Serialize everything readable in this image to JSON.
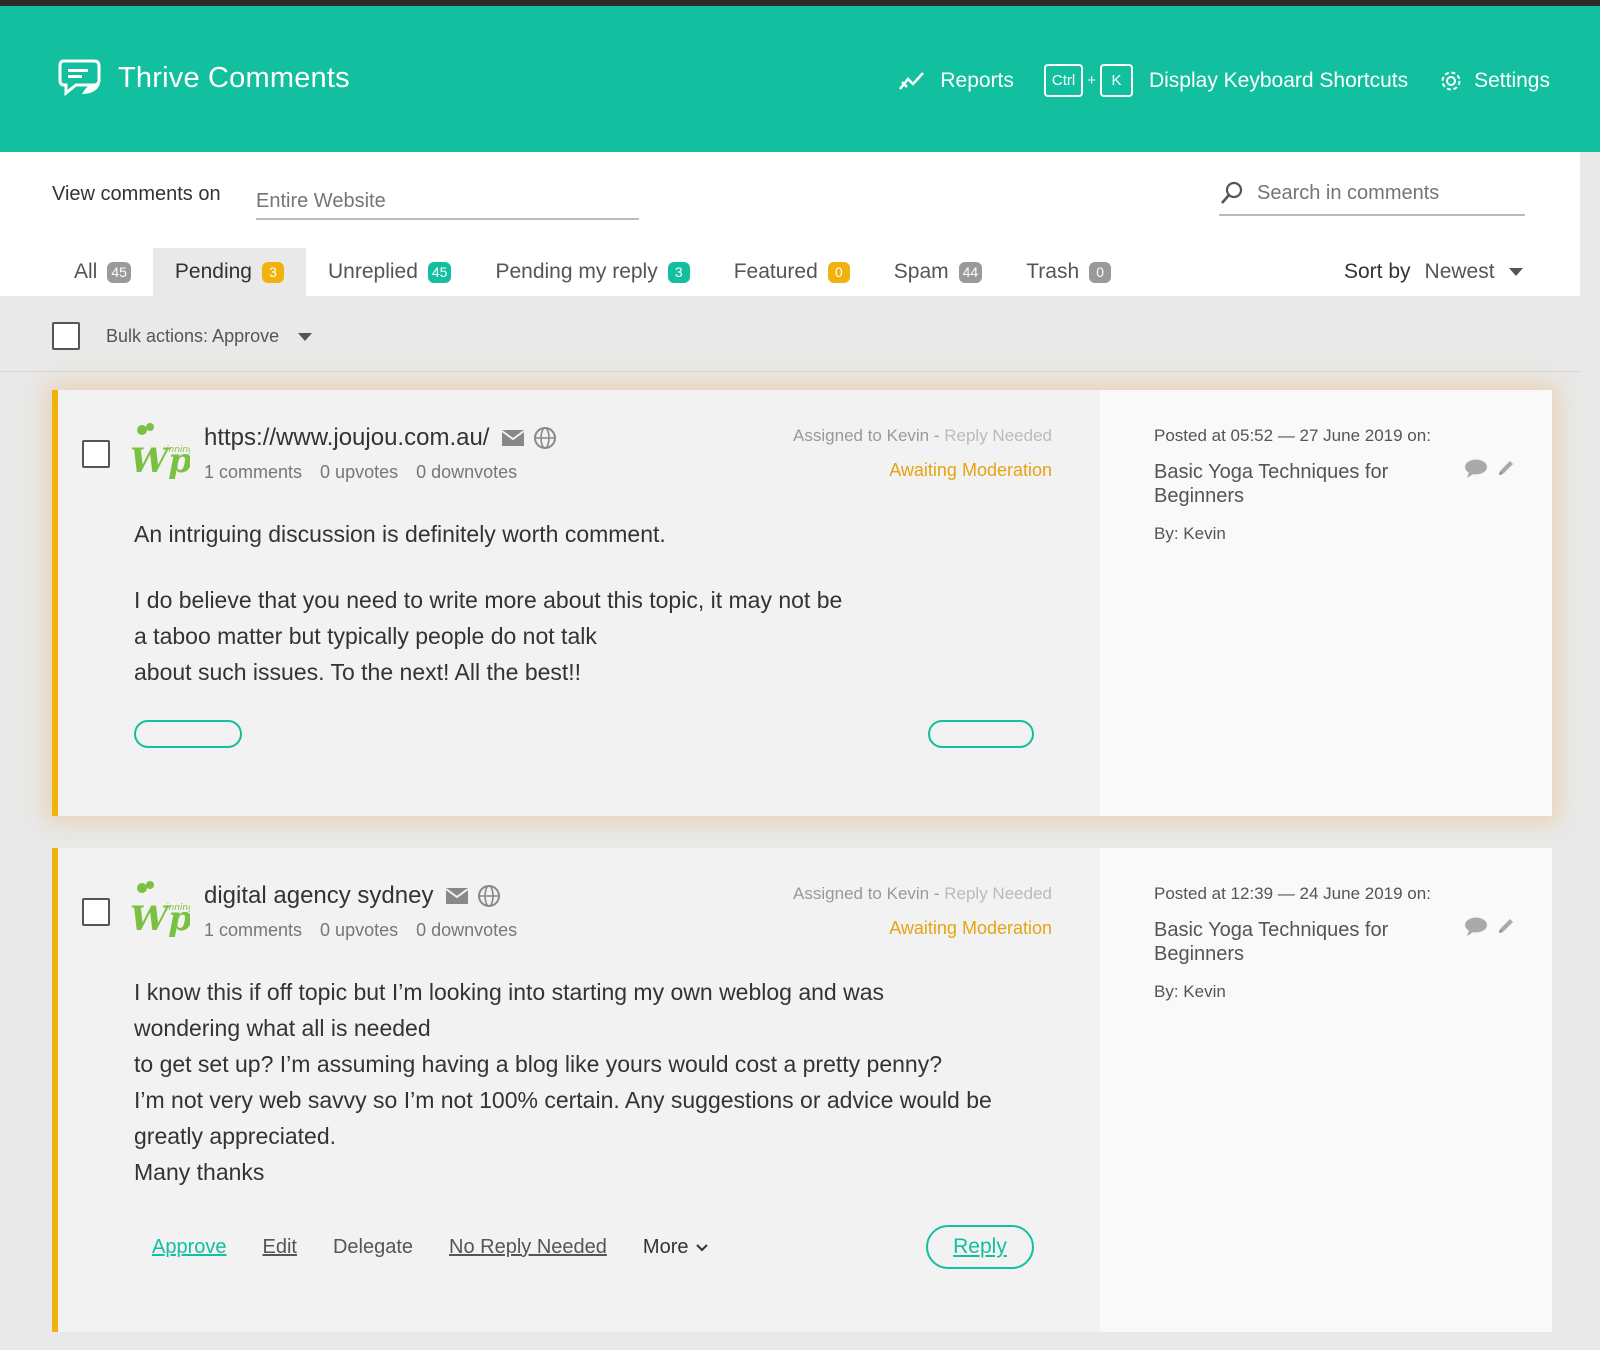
{
  "header": {
    "title": "Thrive Comments",
    "reports": "Reports",
    "kbd_ctrl": "Ctrl",
    "kbd_plus": "+",
    "kbd_k": "K",
    "shortcuts": "Display Keyboard Shortcuts",
    "settings": "Settings"
  },
  "filter": {
    "label": "View comments on",
    "placeholder": "Entire Website",
    "search_placeholder": "Search in comments"
  },
  "tabs": [
    {
      "label": "All",
      "count": "45",
      "color": "#9a9a9a"
    },
    {
      "label": "Pending",
      "count": "3",
      "color": "#f2b20d"
    },
    {
      "label": "Unreplied",
      "count": "45",
      "color": "#12bf9e"
    },
    {
      "label": "Pending my reply",
      "count": "3",
      "color": "#12bf9e"
    },
    {
      "label": "Featured",
      "count": "0",
      "color": "#f2b20d"
    },
    {
      "label": "Spam",
      "count": "44",
      "color": "#9a9a9a"
    },
    {
      "label": "Trash",
      "count": "0",
      "color": "#9a9a9a"
    }
  ],
  "sort": {
    "label": "Sort by",
    "value": "Newest"
  },
  "bulk": {
    "label": "Bulk actions:",
    "value": "Approve"
  },
  "comments": [
    {
      "author": "https://www.joujou.com.au/",
      "comments": "1 comments",
      "upvotes": "0 upvotes",
      "downvotes": "0 downvotes",
      "assigned": "Assigned to Kevin",
      "assigned_sep": " - ",
      "reply_needed": "Reply Needed",
      "status": "Awaiting Moderation",
      "body": [
        "An intriguing discussion is definitely worth comment.",
        "I do believe that you need to write more about this topic, it may not be",
        "a taboo matter but typically people do not talk",
        "about such issues. To the next! All the best!!"
      ],
      "posted": "Posted at 05:52 — 27 June 2019 on:",
      "post_title": "Basic Yoga Techniques for Beginners",
      "by": "By: Kevin"
    },
    {
      "author": "digital agency sydney",
      "comments": "1 comments",
      "upvotes": "0 upvotes",
      "downvotes": "0 downvotes",
      "assigned": "Assigned to Kevin",
      "assigned_sep": " - ",
      "reply_needed": "Reply Needed",
      "status": "Awaiting Moderation",
      "body": [
        "I know this if off topic but I’m looking into starting my own weblog and was",
        "wondering what all is needed",
        "to get set up? I’m assuming having a blog like yours would cost a pretty penny?",
        "I’m not very web savvy so I’m not 100% certain. Any suggestions or advice would be",
        "greatly appreciated.",
        "Many thanks"
      ],
      "posted": "Posted at 12:39 — 24 June 2019 on:",
      "post_title": "Basic Yoga Techniques for Beginners",
      "by": "By: Kevin",
      "actions": {
        "approve": "Approve",
        "edit": "Edit",
        "delegate": "Delegate",
        "no_reply": "No Reply Needed",
        "more": "More",
        "reply": "Reply"
      }
    }
  ],
  "colors": {
    "accent": "#12bf9e",
    "pending": "#f2b20d"
  }
}
